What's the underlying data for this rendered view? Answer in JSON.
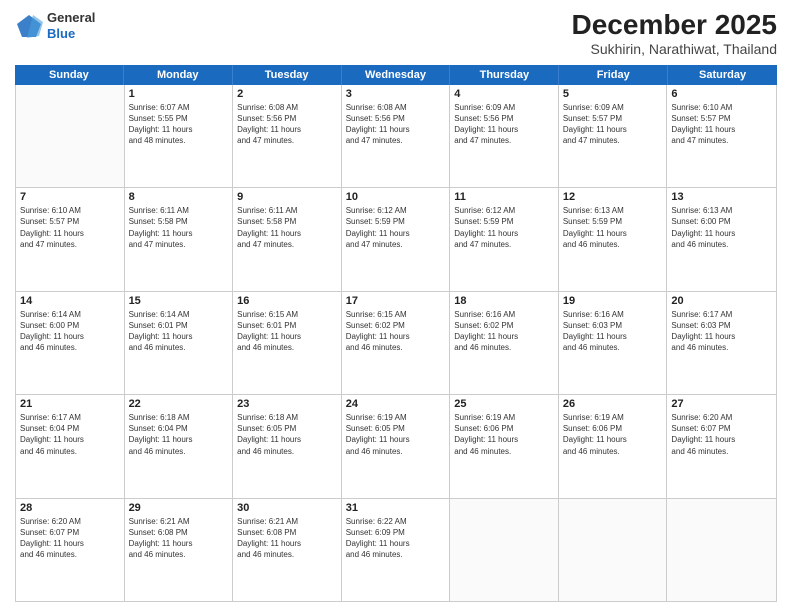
{
  "logo": {
    "general": "General",
    "blue": "Blue"
  },
  "title": "December 2025",
  "subtitle": "Sukhirin, Narathiwat, Thailand",
  "days": [
    "Sunday",
    "Monday",
    "Tuesday",
    "Wednesday",
    "Thursday",
    "Friday",
    "Saturday"
  ],
  "weeks": [
    [
      {
        "day": "",
        "info": ""
      },
      {
        "day": "1",
        "info": "Sunrise: 6:07 AM\nSunset: 5:55 PM\nDaylight: 11 hours\nand 48 minutes."
      },
      {
        "day": "2",
        "info": "Sunrise: 6:08 AM\nSunset: 5:56 PM\nDaylight: 11 hours\nand 47 minutes."
      },
      {
        "day": "3",
        "info": "Sunrise: 6:08 AM\nSunset: 5:56 PM\nDaylight: 11 hours\nand 47 minutes."
      },
      {
        "day": "4",
        "info": "Sunrise: 6:09 AM\nSunset: 5:56 PM\nDaylight: 11 hours\nand 47 minutes."
      },
      {
        "day": "5",
        "info": "Sunrise: 6:09 AM\nSunset: 5:57 PM\nDaylight: 11 hours\nand 47 minutes."
      },
      {
        "day": "6",
        "info": "Sunrise: 6:10 AM\nSunset: 5:57 PM\nDaylight: 11 hours\nand 47 minutes."
      }
    ],
    [
      {
        "day": "7",
        "info": "Sunrise: 6:10 AM\nSunset: 5:57 PM\nDaylight: 11 hours\nand 47 minutes."
      },
      {
        "day": "8",
        "info": "Sunrise: 6:11 AM\nSunset: 5:58 PM\nDaylight: 11 hours\nand 47 minutes."
      },
      {
        "day": "9",
        "info": "Sunrise: 6:11 AM\nSunset: 5:58 PM\nDaylight: 11 hours\nand 47 minutes."
      },
      {
        "day": "10",
        "info": "Sunrise: 6:12 AM\nSunset: 5:59 PM\nDaylight: 11 hours\nand 47 minutes."
      },
      {
        "day": "11",
        "info": "Sunrise: 6:12 AM\nSunset: 5:59 PM\nDaylight: 11 hours\nand 47 minutes."
      },
      {
        "day": "12",
        "info": "Sunrise: 6:13 AM\nSunset: 5:59 PM\nDaylight: 11 hours\nand 46 minutes."
      },
      {
        "day": "13",
        "info": "Sunrise: 6:13 AM\nSunset: 6:00 PM\nDaylight: 11 hours\nand 46 minutes."
      }
    ],
    [
      {
        "day": "14",
        "info": "Sunrise: 6:14 AM\nSunset: 6:00 PM\nDaylight: 11 hours\nand 46 minutes."
      },
      {
        "day": "15",
        "info": "Sunrise: 6:14 AM\nSunset: 6:01 PM\nDaylight: 11 hours\nand 46 minutes."
      },
      {
        "day": "16",
        "info": "Sunrise: 6:15 AM\nSunset: 6:01 PM\nDaylight: 11 hours\nand 46 minutes."
      },
      {
        "day": "17",
        "info": "Sunrise: 6:15 AM\nSunset: 6:02 PM\nDaylight: 11 hours\nand 46 minutes."
      },
      {
        "day": "18",
        "info": "Sunrise: 6:16 AM\nSunset: 6:02 PM\nDaylight: 11 hours\nand 46 minutes."
      },
      {
        "day": "19",
        "info": "Sunrise: 6:16 AM\nSunset: 6:03 PM\nDaylight: 11 hours\nand 46 minutes."
      },
      {
        "day": "20",
        "info": "Sunrise: 6:17 AM\nSunset: 6:03 PM\nDaylight: 11 hours\nand 46 minutes."
      }
    ],
    [
      {
        "day": "21",
        "info": "Sunrise: 6:17 AM\nSunset: 6:04 PM\nDaylight: 11 hours\nand 46 minutes."
      },
      {
        "day": "22",
        "info": "Sunrise: 6:18 AM\nSunset: 6:04 PM\nDaylight: 11 hours\nand 46 minutes."
      },
      {
        "day": "23",
        "info": "Sunrise: 6:18 AM\nSunset: 6:05 PM\nDaylight: 11 hours\nand 46 minutes."
      },
      {
        "day": "24",
        "info": "Sunrise: 6:19 AM\nSunset: 6:05 PM\nDaylight: 11 hours\nand 46 minutes."
      },
      {
        "day": "25",
        "info": "Sunrise: 6:19 AM\nSunset: 6:06 PM\nDaylight: 11 hours\nand 46 minutes."
      },
      {
        "day": "26",
        "info": "Sunrise: 6:19 AM\nSunset: 6:06 PM\nDaylight: 11 hours\nand 46 minutes."
      },
      {
        "day": "27",
        "info": "Sunrise: 6:20 AM\nSunset: 6:07 PM\nDaylight: 11 hours\nand 46 minutes."
      }
    ],
    [
      {
        "day": "28",
        "info": "Sunrise: 6:20 AM\nSunset: 6:07 PM\nDaylight: 11 hours\nand 46 minutes."
      },
      {
        "day": "29",
        "info": "Sunrise: 6:21 AM\nSunset: 6:08 PM\nDaylight: 11 hours\nand 46 minutes."
      },
      {
        "day": "30",
        "info": "Sunrise: 6:21 AM\nSunset: 6:08 PM\nDaylight: 11 hours\nand 46 minutes."
      },
      {
        "day": "31",
        "info": "Sunrise: 6:22 AM\nSunset: 6:09 PM\nDaylight: 11 hours\nand 46 minutes."
      },
      {
        "day": "",
        "info": ""
      },
      {
        "day": "",
        "info": ""
      },
      {
        "day": "",
        "info": ""
      }
    ]
  ]
}
